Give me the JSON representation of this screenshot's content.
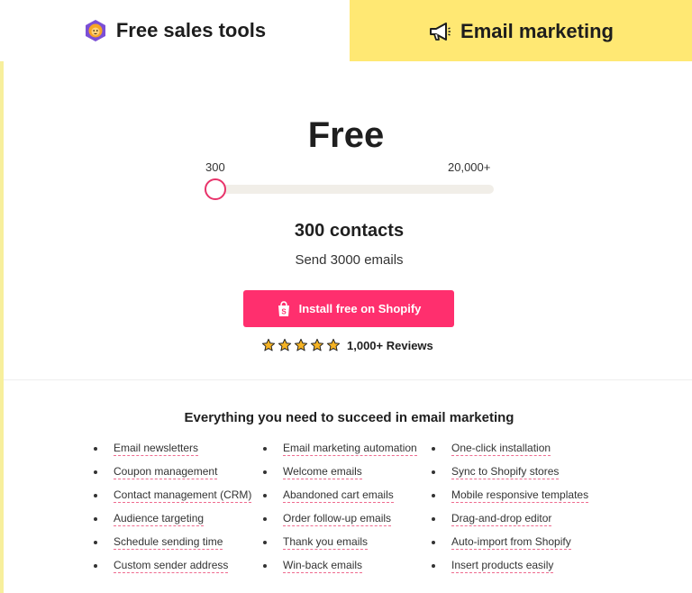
{
  "tabs": {
    "sales": {
      "label": "Free sales tools",
      "icon": "lion-badge-icon"
    },
    "email": {
      "label": "Email marketing",
      "icon": "megaphone-icon"
    }
  },
  "plan": {
    "price": "Free",
    "range_min": "300",
    "range_max": "20,000+",
    "slider_level": 0,
    "contacts": "300 contacts",
    "emails": "Send 3000 emails"
  },
  "cta": {
    "label": "Install free on Shopify",
    "icon": "shopify-bag-icon"
  },
  "rating": {
    "stars": 5,
    "reviews": "1,000+ Reviews"
  },
  "features": {
    "title": "Everything you need to succeed in email marketing",
    "col1": [
      "Email newsletters",
      "Coupon management",
      "Contact management (CRM)",
      "Audience targeting",
      "Schedule sending time",
      "Custom sender address"
    ],
    "col2": [
      "Email marketing automation",
      "Welcome emails",
      "Abandoned cart emails",
      "Order follow-up emails",
      "Thank you emails",
      "Win-back emails"
    ],
    "col3": [
      "One-click installation",
      "Sync to Shopify stores",
      "Mobile responsive templates",
      "Drag-and-drop editor",
      "Auto-import from Shopify",
      "Insert products easily"
    ]
  },
  "colors": {
    "accent": "#ff2f6e",
    "tab_active": "#ffe873",
    "star": "#f5b324"
  }
}
